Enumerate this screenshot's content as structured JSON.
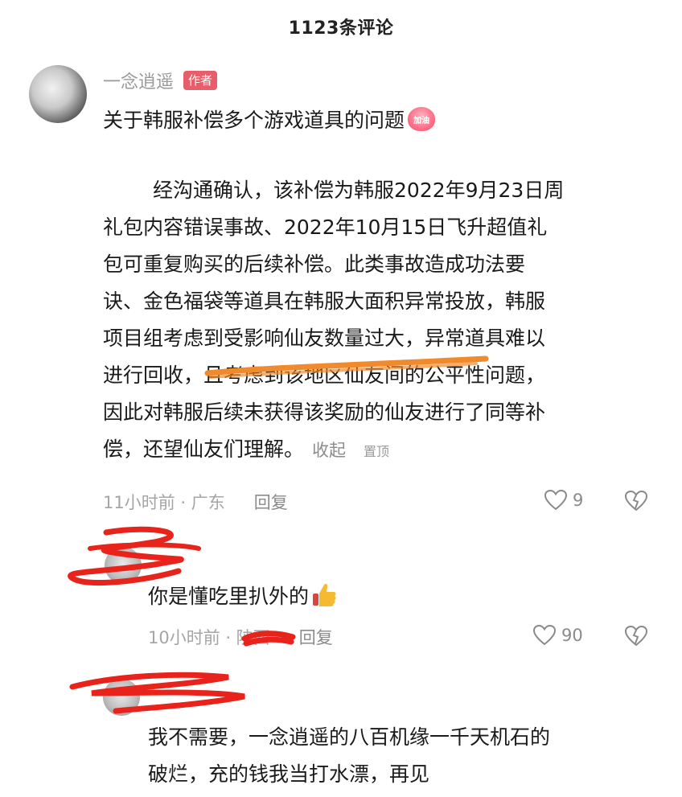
{
  "header": {
    "title": "1123条评论"
  },
  "comments": [
    {
      "username": "一念逍遥",
      "badge": "作者",
      "title": "关于韩服补偿多个游戏道具的问题",
      "title_emoji_text": "加油",
      "body_lines": [
        "经沟通确认，该补偿为韩服2022年9月23日周",
        "礼包内容错误事故、2022年10月15日飞升超值礼",
        "包可重复购买的后续补偿。此类事故造成功法要",
        "诀、金色福袋等道具在韩服大面积异常投放，韩服",
        "项目组考虑到受影响仙友数量过大，异常道具难以",
        "进行回收，且考虑到该地区仙友间的公平性问题，",
        "因此对韩服后续未获得该奖励的仙友进行了同等补",
        "偿，还望仙友们理解。"
      ],
      "collapse_label": "收起",
      "pin_label": "置顶",
      "time": "11小时前 · 广东",
      "reply_label": "回复",
      "likes": "9"
    },
    {
      "text": "你是懂吃里扒外的",
      "time": "10小时前 · 陕西",
      "reply_label": "回复",
      "likes": "90"
    },
    {
      "lines": [
        "我不需要，一念逍遥的八百机缘一千天机石的",
        "破烂，充的钱我当打水漂，再见"
      ]
    }
  ],
  "colors": {
    "badge": "#e85d6a",
    "scribble_red": "#e8231c",
    "underline_orange": "#f08a2c",
    "meta_gray": "#a5a5a5"
  }
}
